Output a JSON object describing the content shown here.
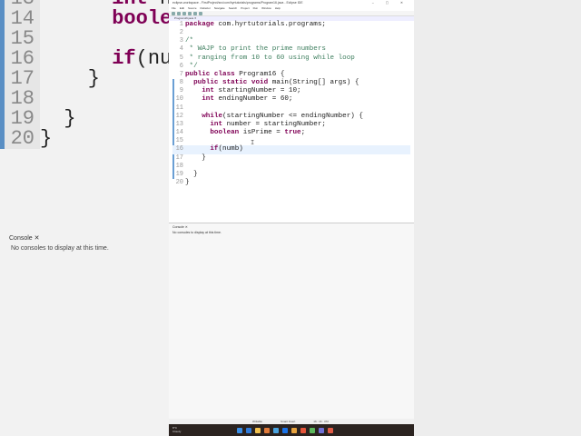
{
  "window": {
    "title": "eclipse-workspace - FirstProject/src/com/hyrtutorials/programs/Program16.java - Eclipse IDE",
    "controls": "–  ▢  ✕"
  },
  "menu": [
    "File",
    "Edit",
    "Source",
    "Refactor",
    "Navigate",
    "Search",
    "Project",
    "Run",
    "Window",
    "Help"
  ],
  "editor_tab": "Program16.java ✕",
  "code": [
    [
      {
        "t": "package",
        "c": "kw"
      },
      {
        "t": " com.hyrtutorials.programs;"
      }
    ],
    [],
    [
      {
        "t": "/*",
        "c": "cm"
      }
    ],
    [
      {
        "t": " * WAJP to print the prime numbers",
        "c": "cm"
      }
    ],
    [
      {
        "t": " * ranging from 10 to 60 using while loop",
        "c": "cm"
      }
    ],
    [
      {
        "t": " */",
        "c": "cm"
      }
    ],
    [
      {
        "t": "public class",
        "c": "kw"
      },
      {
        "t": " Program16 {"
      }
    ],
    [
      {
        "t": "  "
      },
      {
        "t": "public static void",
        "c": "kw"
      },
      {
        "t": " main(String[] args) {"
      }
    ],
    [
      {
        "t": "    "
      },
      {
        "t": "int",
        "c": "kw"
      },
      {
        "t": " startingNumber = 10;"
      }
    ],
    [
      {
        "t": "    "
      },
      {
        "t": "int",
        "c": "kw"
      },
      {
        "t": " endingNumber = 60;"
      }
    ],
    [],
    [
      {
        "t": "    "
      },
      {
        "t": "while",
        "c": "kw"
      },
      {
        "t": "(startingNumber <= endingNumber) {"
      }
    ],
    [
      {
        "t": "      "
      },
      {
        "t": "int",
        "c": "kw"
      },
      {
        "t": " number = startingNumber;"
      }
    ],
    [
      {
        "t": "      "
      },
      {
        "t": "boolean",
        "c": "kw"
      },
      {
        "t": " isPrime = "
      },
      {
        "t": "true",
        "c": "kw"
      },
      {
        "t": ";"
      }
    ],
    [],
    [
      {
        "t": "      "
      },
      {
        "t": "if",
        "c": "kw"
      },
      {
        "t": "(numb)"
      }
    ],
    [
      {
        "t": "    }"
      }
    ],
    [],
    [
      {
        "t": "  }"
      }
    ],
    [
      {
        "t": "}"
      }
    ]
  ],
  "current_line": 16,
  "console": {
    "tab": "Console ✕",
    "message": "No consoles to display at this time."
  },
  "status": [
    "Writable",
    "Smart Insert",
    "16 : 16 : 372"
  ],
  "weather": {
    "temp": "8°C",
    "desc": "Cloudy"
  },
  "taskbar_colors": [
    "#3a8ee6",
    "#2f7ad9",
    "#f2c14e",
    "#e07a3a",
    "#4aa3df",
    "#1a73e8",
    "#e8a33d",
    "#e6553a",
    "#5cb85c",
    "#6f6fd6",
    "#e25b45"
  ]
}
